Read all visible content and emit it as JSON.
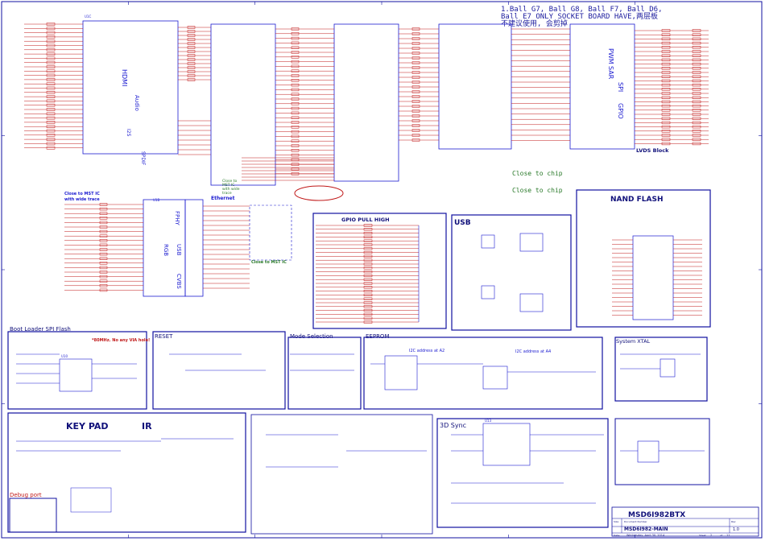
{
  "header": {
    "note_line1": "1.Ball G7, Ball G8, Ball F7, Ball D6,",
    "note_line2": "Ball E7 ONLY SOCKET BOARD HAVE,两层板",
    "note_line3": "不建议使用, 会剪掉"
  },
  "side_labels": {
    "pwm": "PWM",
    "sar": "SAR",
    "spi": "SPI",
    "gpio": "GPIO",
    "hdmi": "HDMI",
    "audio": "Audio",
    "i2s": "I2S",
    "spdif": "SPDIF",
    "rgb": "RGB",
    "usb": "USB",
    "cvbs": "CVBS",
    "fphy": "FPHY"
  },
  "blocks": {
    "lvds": "LVDS Block",
    "nand": "NAND FLASH",
    "ethernet": "Ethernet",
    "gpio_pull": "GPIO PULL HIGH",
    "usb": "USB",
    "boot": "Boot Loader SPI Flash",
    "boot_note": "*80MHz. No any VIA hole!",
    "reset": "RESET",
    "mode": "Mode Selection",
    "eeprom": "EEPROM",
    "sysxtal": "System XTAL",
    "keypad": "KEY PAD",
    "ir": "IR",
    "debug": "Debug port",
    "sync3d": "3D Sync"
  },
  "notes": {
    "close_chip_1": "Close to chip",
    "close_chip_2": "Close to chip",
    "close_mst_1": "Close to MST IC",
    "close_mst_2": "with wide trace",
    "close_mst_eth": "Close to MST IC",
    "close_to_1": "Close to",
    "close_to_2": "MST IC",
    "close_to_3": "with wide",
    "close_to_4": "trace",
    "i2c_a2": "I2C address at A2",
    "i2c_a4": "I2C address at A4"
  },
  "title_block": {
    "title": "MSD6I982BTX",
    "doc": "MSD6I982-MAIN",
    "size_label": "Size",
    "doc_label": "Document Number",
    "rev_label": "Rev",
    "rev": "1.0",
    "date_label": "Date:",
    "date": "Wednesday, April 30, 2014",
    "sheet_label": "Sheet",
    "sheet": "2",
    "of_label": "of",
    "of": "11"
  },
  "parts": {
    "u_main": "U1C",
    "u_nand": "U9",
    "u_boot": "U10",
    "u_eeprom": "U11",
    "u_sync": "U13"
  },
  "colors": {
    "line": "#1b1bd0",
    "net": "#c01818",
    "text": "#10107a",
    "frame": "#1010a0",
    "note_green": "#2a7a2a"
  }
}
